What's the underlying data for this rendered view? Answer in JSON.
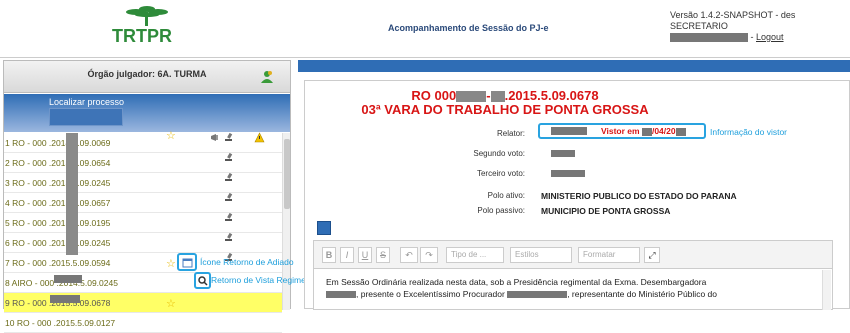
{
  "header": {
    "logo_text": "TRTPR",
    "app_title": "Acompanhamento de Sessão do PJ-e",
    "version": "Versão 1.4.2-SNAPSHOT - des",
    "role": "SECRETARIO",
    "logout": "Logout"
  },
  "left": {
    "orgao_label": "Órgão julgador: 6A. TURMA",
    "search_label": "Localizar processo",
    "rows": [
      {
        "text": "1 RO - 000        .2014.5.09.0069"
      },
      {
        "text": "2 RO - 000        .2013.5.09.0654"
      },
      {
        "text": "3 RO - 000        .2013.5.09.0245"
      },
      {
        "text": "4 RO - 000        .2015.5.09.0657"
      },
      {
        "text": "5 RO - 000        .2015.5.09.0195"
      },
      {
        "text": "6 RO - 000        .2015.5.09.0245"
      },
      {
        "text": "7 RO - 000        .2015.5.09.0594"
      },
      {
        "text": "8 AIRO - 000      .2014.5.09.0245"
      },
      {
        "text": "9 RO - 000        .2015.5.09.0678"
      },
      {
        "text": "10 RO - 000       .2015.5.09.0127"
      }
    ],
    "annot_adiado": "Ícone Retorno de Adiado",
    "annot_vista": "Retorno de Vista Regimental"
  },
  "right": {
    "case_title_a": "RO 000",
    "case_title_b": "-",
    "case_title_c": ".2015.5.09.0678",
    "case_sub": "03ª VARA DO TRABALHO DE PONTA GROSSA",
    "relator_label": "Relator:",
    "vistor_text": "Vistor em",
    "vistor_date": "/04/20",
    "annot_vistor": "Informação do vistor",
    "segundo_label": "Segundo voto:",
    "terceiro_label": "Terceiro voto:",
    "polo_ativo_label": "Polo ativo:",
    "polo_ativo": "MINISTERIO PUBLICO DO ESTADO DO PARANA",
    "polo_passivo_label": "Polo passivo:",
    "polo_passivo": "MUNICIPIO DE PONTA GROSSA",
    "toolbar": {
      "bold": "B",
      "italic": "I",
      "underline": "U",
      "strike": "S",
      "undo": "↶",
      "redo": "↷",
      "tipo": "Tipo de ...",
      "estilos": "Estilos",
      "formatar": "Formatar",
      "maximize": "⤢"
    },
    "editor_line1": "Em Sessão Ordinária realizada nesta data, sob a Presidência regimental  da Exma. Desembargadora",
    "editor_line2": ", presente o Excelentíssimo Procurador",
    "editor_line2b": ", representante do Ministério Público do"
  }
}
